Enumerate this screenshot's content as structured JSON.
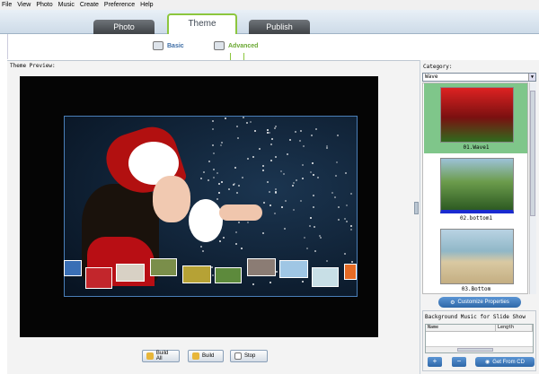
{
  "menu": {
    "items": [
      "File",
      "View",
      "Photo",
      "Music",
      "Create",
      "Preference",
      "Help"
    ]
  },
  "tabs": [
    {
      "label": "Photo"
    },
    {
      "label": "Theme"
    },
    {
      "label": "Publish"
    }
  ],
  "subtabs": [
    {
      "label": "Basic"
    },
    {
      "label": "Advanced"
    }
  ],
  "preview": {
    "label": "Theme Preview:"
  },
  "buttons": {
    "build_all": "Build All",
    "build": "Build",
    "stop": "Stop"
  },
  "category": {
    "label": "Category:",
    "selected": "Wave"
  },
  "themes": [
    {
      "caption": "01.Wave1",
      "selected": true
    },
    {
      "caption": "02.bottom1",
      "selected": false
    },
    {
      "caption": "03.Bottom",
      "selected": false
    }
  ],
  "customize": {
    "label": "Customize Properties"
  },
  "music": {
    "title": "Background Music for Slide Show",
    "col_name": "Name",
    "col_length": "Length",
    "add": "+",
    "remove": "−",
    "cd_button": "Get From CD"
  },
  "colors": {
    "accent_green": "#8cc63e",
    "selected_theme": "#7fc68a",
    "button_blue": "#2f68a8",
    "tab_dark": "#3e4246"
  }
}
